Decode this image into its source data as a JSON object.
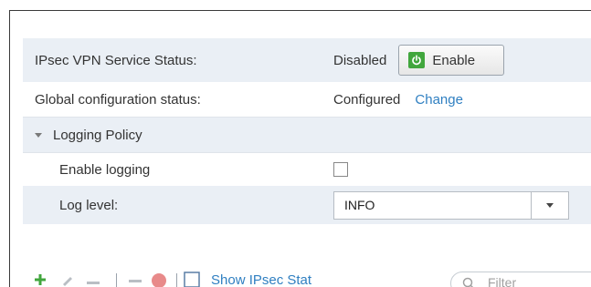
{
  "ipsec": {
    "service_status_label": "IPsec VPN Service Status:",
    "service_status_value": "Disabled",
    "enable_button_label": "Enable",
    "global_config_label": "Global configuration status:",
    "global_config_value": "Configured",
    "change_link": "Change"
  },
  "logging": {
    "section_title": "Logging Policy",
    "enable_logging_label": "Enable logging",
    "enable_logging_checked": false,
    "log_level_label": "Log level:",
    "log_level_value": "INFO"
  },
  "toolbar": {
    "show_stats_link": "Show IPsec Stat",
    "filter_placeholder": "Filter"
  },
  "icons": {
    "power": "power-icon",
    "collapse": "chevron-down-icon",
    "dropdown": "chevron-down-icon",
    "add": "add-icon",
    "edit": "edit-icon",
    "delete": "delete-icon",
    "search": "search-icon"
  },
  "colors": {
    "accent_link": "#2f7fc1",
    "power_green": "#41a63d",
    "row_shade": "#eaeff5"
  }
}
